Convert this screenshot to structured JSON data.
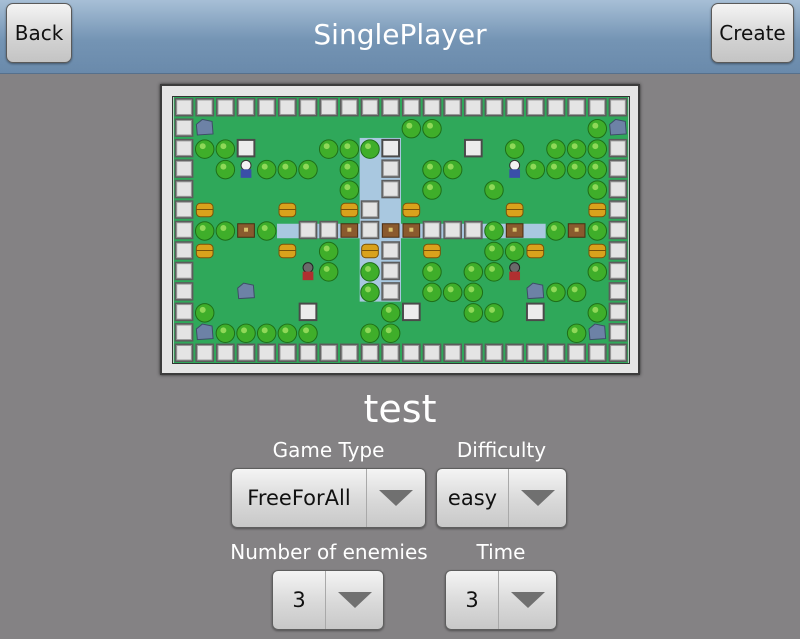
{
  "header": {
    "title": "SinglePlayer",
    "back_label": "Back",
    "create_label": "Create"
  },
  "map": {
    "name": "test",
    "grid": [
      "WWWWWWWWWWWWWWWWWWWWWW",
      "WR.........GG.......GRW",
      "WGGP...GGGP.S.P.G.GGGW",
      "W.GHGGG.G.W.GG..HGGGGW",
      "W.......G.W.G..G....GW",
      "WC...C..CW.C....C...CW",
      "WGGTG.WWTWTTWWWGT.GTGW",
      "WC...C.G.CW.C..GGC..CW",
      "W.....EG.GW.G.GGE...GW",
      "W..R.....GW.GGG..RGG.W",
      "WG....P...GP..GG.P..GW",
      "WRGGGGG..GG........GRW",
      "WWWWWWWWWWWWWWWWWWWWWW"
    ],
    "legend": {
      "W": "indestructible-wall",
      "P": "steel-block",
      "R": "rock",
      "G": "bush",
      "C": "gold-barrel",
      "T": "treasure-chest",
      "H": "player-character",
      "E": "enemy-character",
      "~": "water"
    },
    "water": [
      {
        "col": 9,
        "row": 2,
        "len": 8,
        "dir": "v"
      },
      {
        "col": 5,
        "row": 6,
        "len": 13,
        "dir": "h"
      }
    ],
    "colors": {
      "grass": "#2fa85a",
      "water": "#a9c8e0",
      "bush": "#3fae2a",
      "wall": "#d6d6d6",
      "frame": "#e6e6e6"
    }
  },
  "settings": {
    "game_type_label": "Game Type",
    "game_type_value": "FreeForAll",
    "difficulty_label": "Difficulty",
    "difficulty_value": "easy",
    "enemies_label": "Number of enemies",
    "enemies_value": "3",
    "time_label": "Time",
    "time_value": "3"
  },
  "icons": {
    "dropdown": "chevron-down-icon"
  }
}
